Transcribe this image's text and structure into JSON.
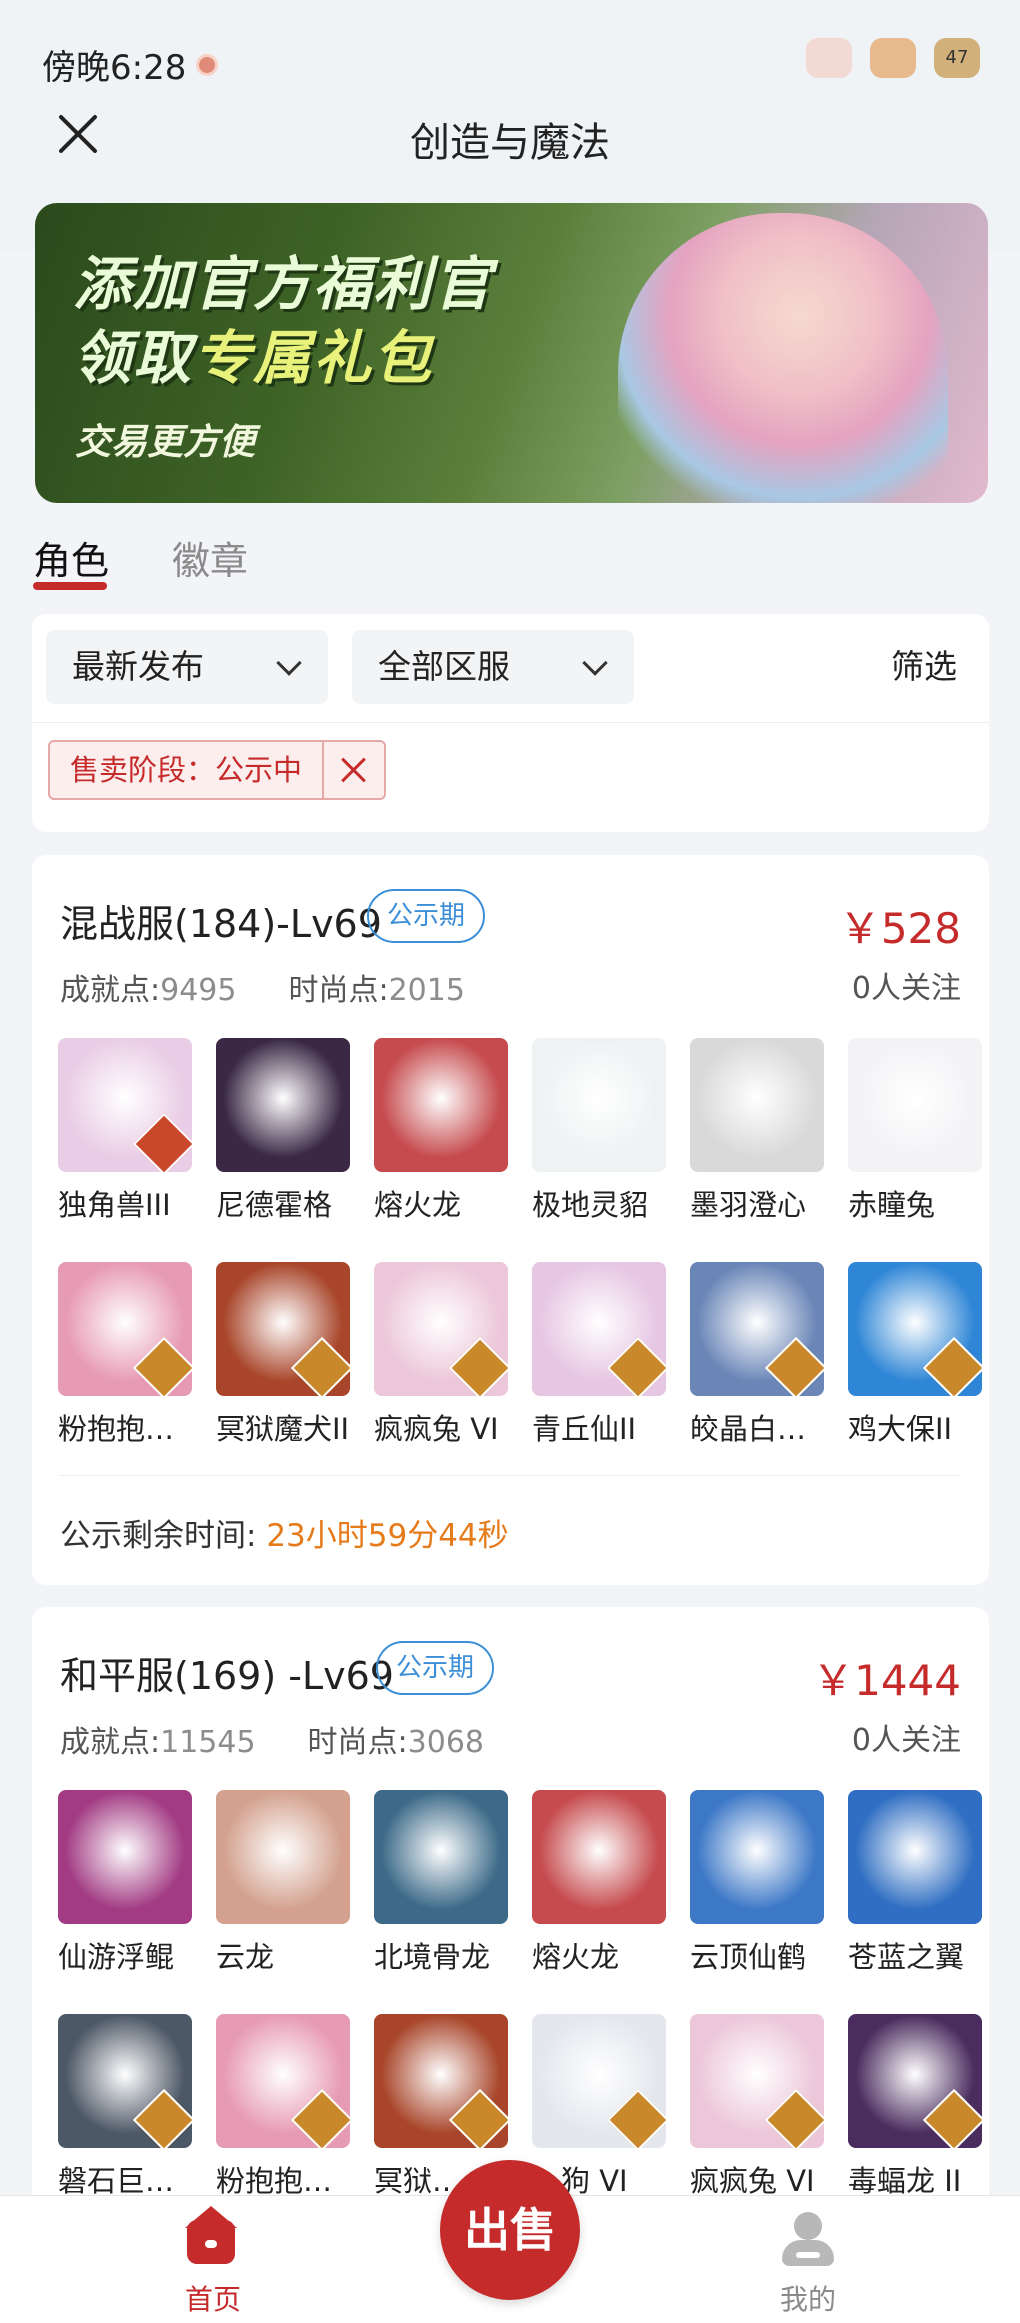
{
  "status_bar": {
    "time": "傍晚6:28",
    "battery": "47"
  },
  "header": {
    "title": "创造与魔法"
  },
  "banner": {
    "line1": "添加官方福利官",
    "line2_prefix": "领取",
    "line2_highlight": "专属礼包",
    "line3": "交易更方便"
  },
  "tabs": [
    {
      "label": "角色",
      "active": true
    },
    {
      "label": "徽章",
      "active": false
    }
  ],
  "filters": {
    "sort": "最新发布",
    "server": "全部区服",
    "filter_label": "筛选",
    "active_tag": "售卖阶段：公示中"
  },
  "listings": [
    {
      "server": "混战服(184)-Lv69",
      "badge": "公示期",
      "price": "￥528",
      "achievement_label": "成就点:",
      "achievement": "9495",
      "fashion_label": "时尚点:",
      "fashion": "2015",
      "follow": "0人关注",
      "items": [
        {
          "name": "独角兽III",
          "color": "#e9cde6",
          "grade": "#c8482b"
        },
        {
          "name": "尼德霍格",
          "color": "#3a2845",
          "grade": ""
        },
        {
          "name": "熔火龙",
          "color": "#c64b4e",
          "grade": ""
        },
        {
          "name": "极地灵貂",
          "color": "#eef2f3",
          "grade": ""
        },
        {
          "name": "墨羽澄心",
          "color": "#d9d9d9",
          "grade": ""
        },
        {
          "name": "赤瞳兔",
          "color": "#f3f3f6",
          "grade": ""
        },
        {
          "name": "粉抱抱…",
          "color": "#e79ab4",
          "grade": "#c9892b"
        },
        {
          "name": "冥狱魔犬II",
          "color": "#a8452a",
          "grade": "#c9892b"
        },
        {
          "name": "疯疯兔 VI",
          "color": "#ecc7d9",
          "grade": "#c9892b"
        },
        {
          "name": "青丘仙II",
          "color": "#e6c6e3",
          "grade": "#c9892b"
        },
        {
          "name": "皎晶白…",
          "color": "#6a86b7",
          "grade": "#c9892b"
        },
        {
          "name": "鸡大保II",
          "color": "#2f86d6",
          "grade": "#c9892b"
        }
      ],
      "countdown_label": "公示剩余时间:",
      "countdown": "23小时59分44秒"
    },
    {
      "server": "和平服(169) -Lv69",
      "badge": "公示期",
      "price": "￥1444",
      "achievement_label": "成就点:",
      "achievement": "11545",
      "fashion_label": "时尚点:",
      "fashion": "3068",
      "follow": "0人关注",
      "items": [
        {
          "name": "仙游浮鲲",
          "color": "#a23b83",
          "grade": ""
        },
        {
          "name": "云龙",
          "color": "#d3a18e",
          "grade": ""
        },
        {
          "name": "北境骨龙",
          "color": "#3c6a88",
          "grade": ""
        },
        {
          "name": "熔火龙",
          "color": "#c64b4e",
          "grade": ""
        },
        {
          "name": "云顶仙鹤",
          "color": "#3d78c7",
          "grade": ""
        },
        {
          "name": "苍蓝之翼",
          "color": "#2f6ec2",
          "grade": ""
        },
        {
          "name": "磐石巨…",
          "color": "#4d5866",
          "grade": "#c9892b"
        },
        {
          "name": "粉抱抱…",
          "color": "#e79ab4",
          "grade": "#c9892b"
        },
        {
          "name": "冥狱…",
          "color": "#a8452a",
          "grade": "#c9892b"
        },
        {
          "name": "…狗 VI",
          "color": "#e4e7ee",
          "grade": "#c9892b"
        },
        {
          "name": "疯疯兔 VI",
          "color": "#ecc7d9",
          "grade": "#c9892b"
        },
        {
          "name": "毒蝠龙 II",
          "color": "#4a2c5e",
          "grade": "#c9892b"
        }
      ]
    }
  ],
  "bottom_nav": {
    "home": "首页",
    "sell": "出售",
    "me": "我的"
  }
}
